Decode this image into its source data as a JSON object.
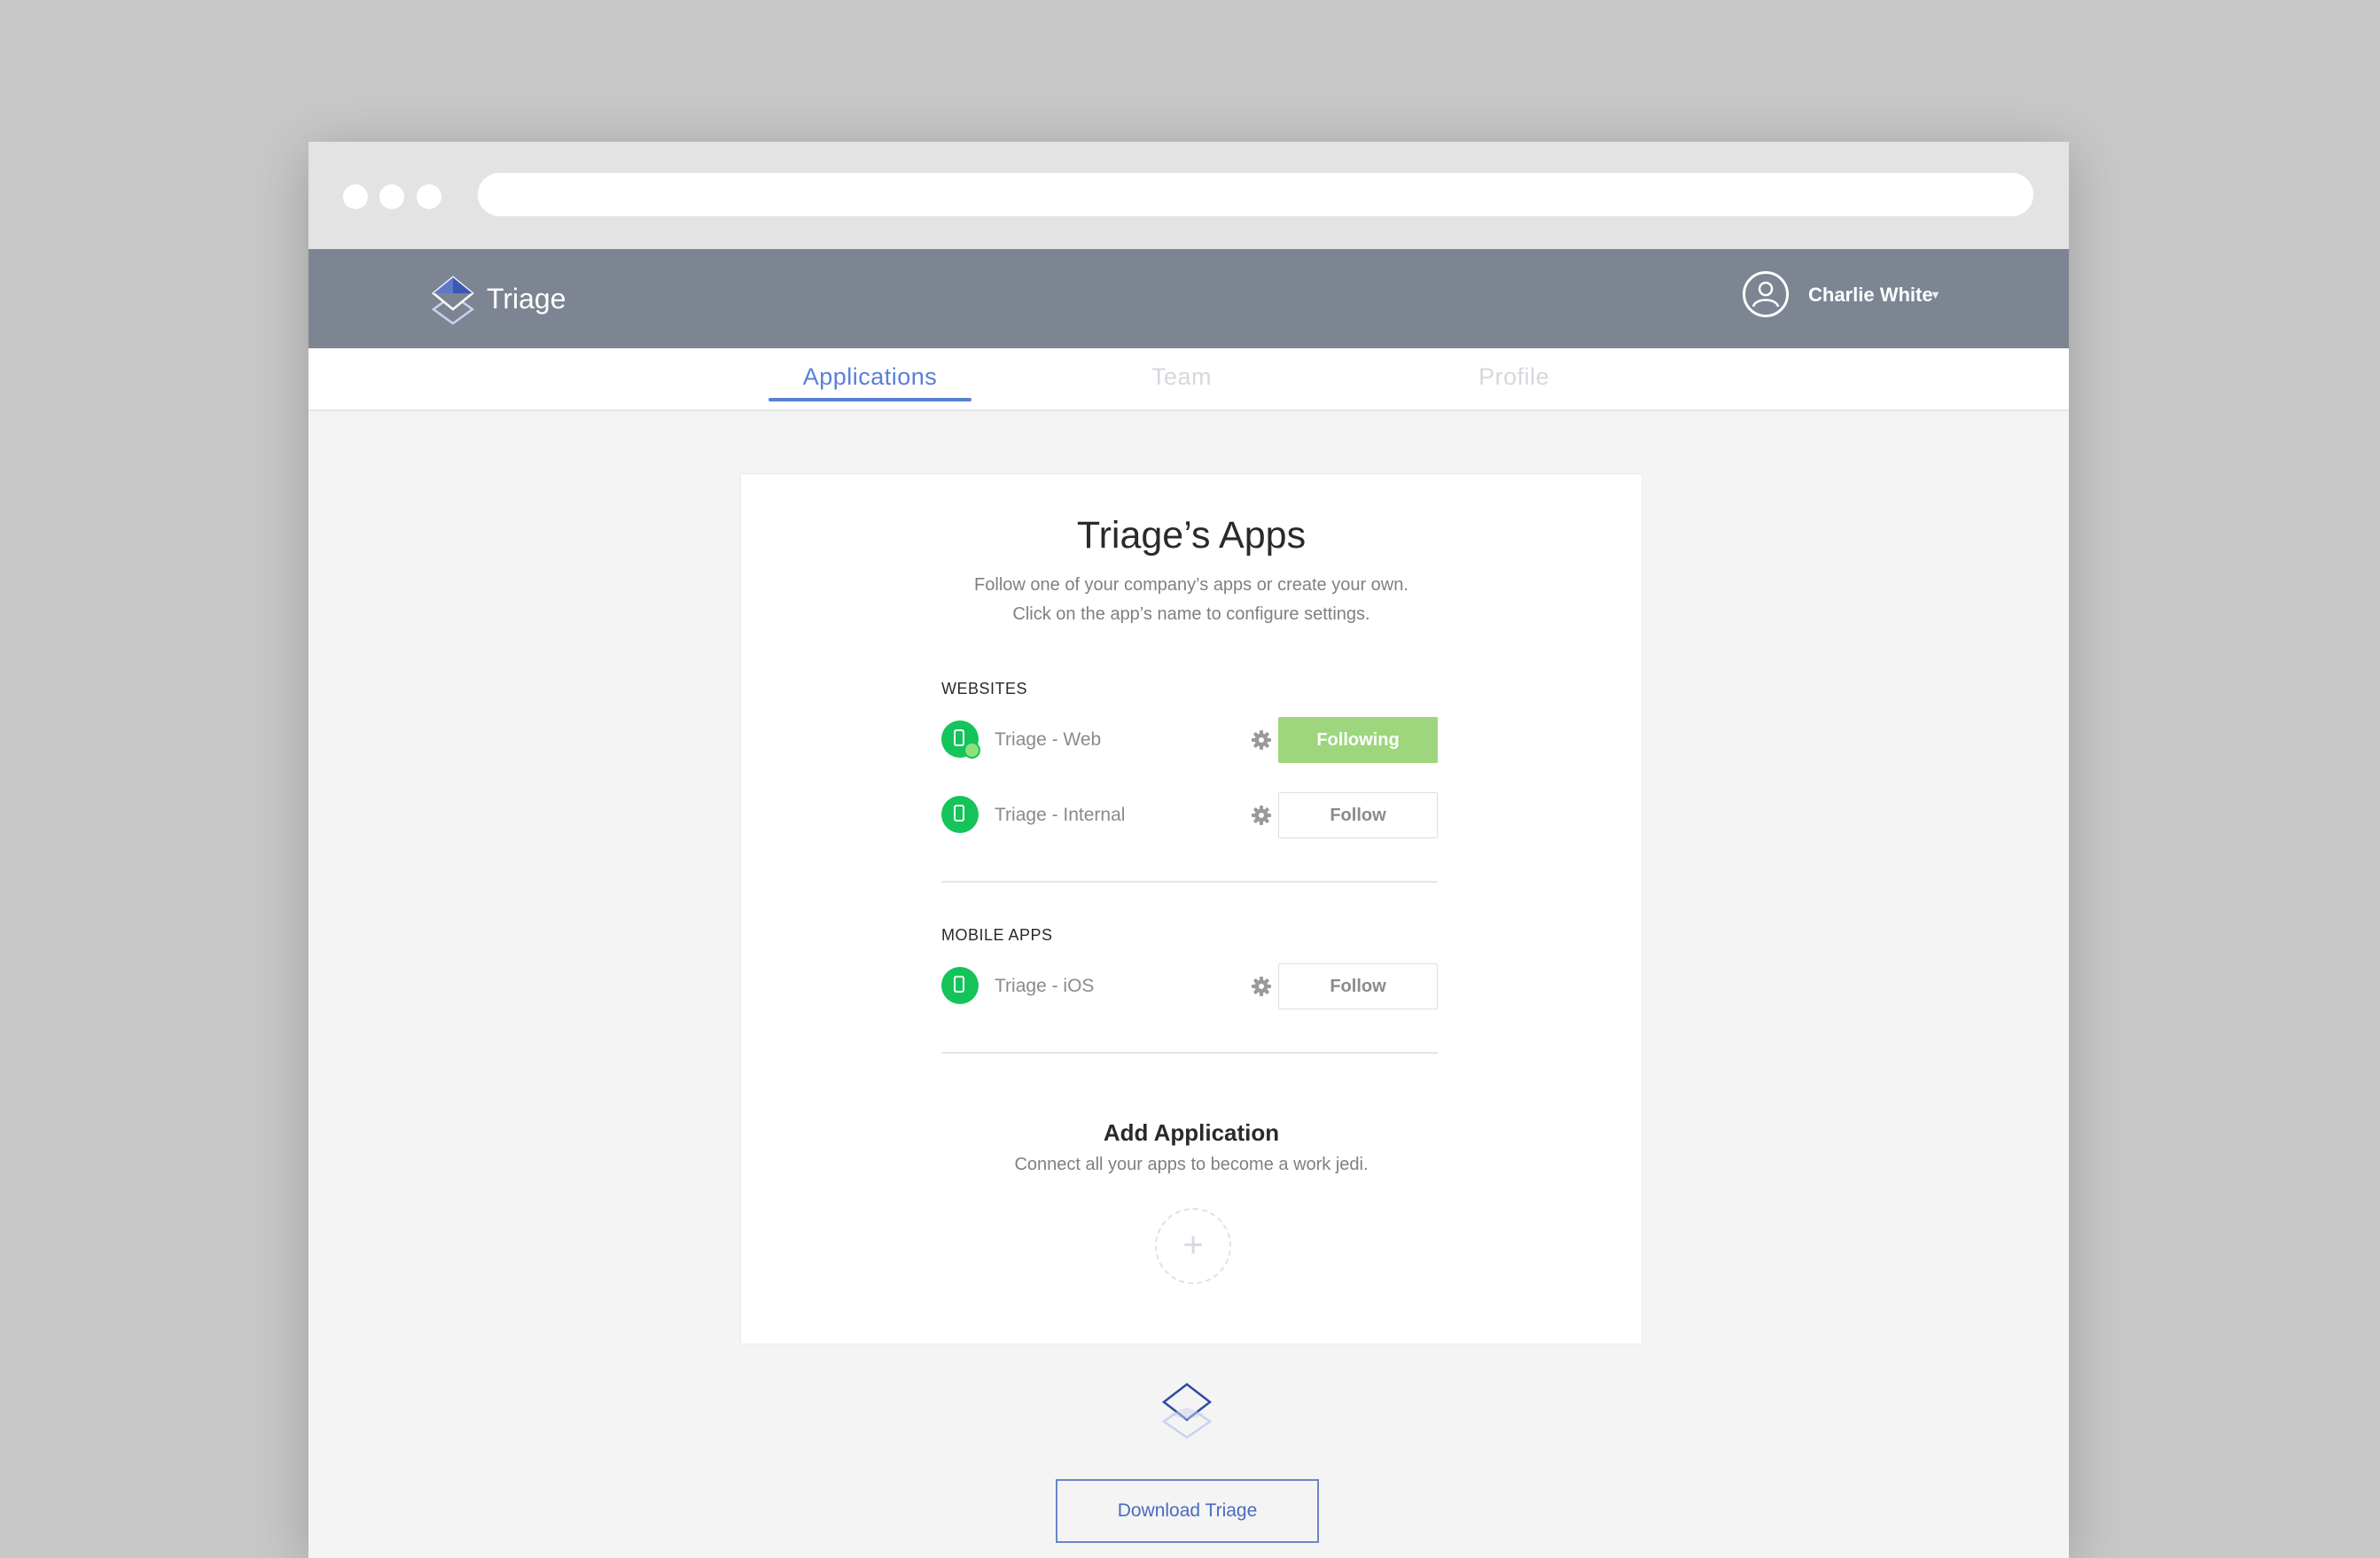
{
  "app": {
    "brand_name": "Triage",
    "user_name": "Charlie White"
  },
  "tabs": [
    {
      "label": "Applications",
      "active": true
    },
    {
      "label": "Team",
      "active": false
    },
    {
      "label": "Profile",
      "active": false
    }
  ],
  "card": {
    "title": "Triage’s Apps",
    "subtitle_line1": "Follow one of your company’s apps or create your own.",
    "subtitle_line2": "Click on the app’s name to configure settings."
  },
  "sections": {
    "websites": {
      "label": "WEBSITES",
      "apps": [
        {
          "name": "Triage - Web",
          "button": "Following",
          "following": true
        },
        {
          "name": "Triage - Internal",
          "button": "Follow",
          "following": false
        }
      ]
    },
    "mobile": {
      "label": "MOBILE APPS",
      "apps": [
        {
          "name": "Triage - iOS",
          "button": "Follow",
          "following": false
        }
      ]
    }
  },
  "add_app": {
    "title": "Add Application",
    "subtitle": "Connect all your apps to become a work jedi.",
    "icon": "plus-icon"
  },
  "footer": {
    "download_label": "Download Triage"
  },
  "colors": {
    "accent": "#5a7fd6",
    "app_bar": "#7d8593",
    "app_icon_green": "#14c45a",
    "following_green": "#9dd67c"
  }
}
